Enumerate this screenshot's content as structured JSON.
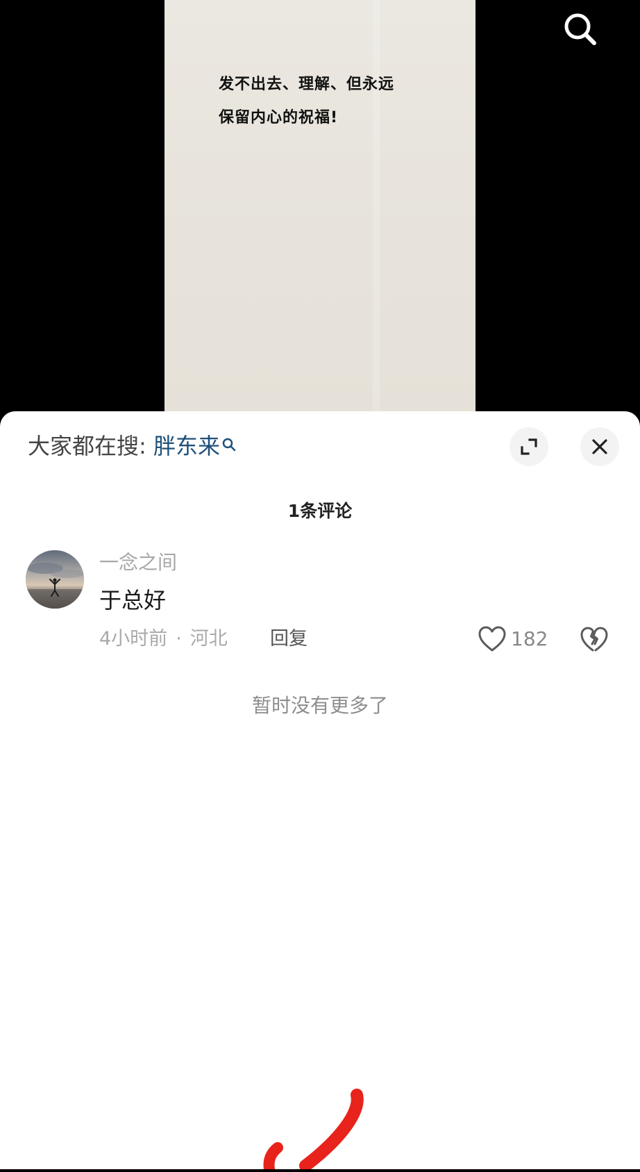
{
  "video": {
    "caption": "发不出去、理解、但永远\n保留内心的祝福!"
  },
  "icons": {
    "top_search": "search-icon",
    "trending_search": "search-icon",
    "expand": "expand-icon",
    "close": "close-icon",
    "like": "heart-icon",
    "dislike": "broken-heart-icon"
  },
  "sheet": {
    "trending_prefix": "大家都在搜: ",
    "trending_term": "胖东来",
    "comment_count_label": "1条评论",
    "end_label": "暂时没有更多了"
  },
  "comment": {
    "username": "一念之间",
    "text": "于总好",
    "time": "4小时前",
    "separator": "·",
    "location": "河北",
    "reply_label": "回复",
    "like_count": "182"
  },
  "colors": {
    "trending_term": "#1e4f7a",
    "annotation": "#e8231b",
    "video_bg": "#e8e4dc"
  }
}
